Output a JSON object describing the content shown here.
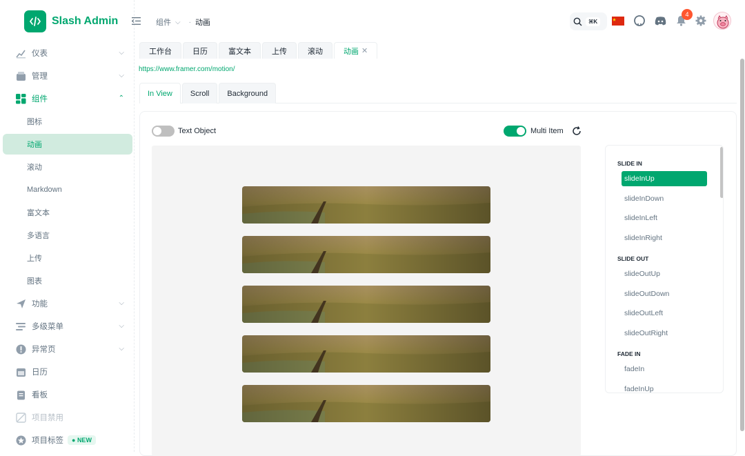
{
  "app": {
    "title": "Slash Admin"
  },
  "sidebar": {
    "items": [
      {
        "label": "仪表",
        "icon": "dashboard-icon",
        "expandable": true
      },
      {
        "label": "管理",
        "icon": "management-icon",
        "expandable": true
      },
      {
        "label": "组件",
        "icon": "components-icon",
        "expandable": true,
        "open": true
      },
      {
        "label": "功能",
        "icon": "send-icon",
        "expandable": true
      },
      {
        "label": "多级菜单",
        "icon": "menu-levels-icon",
        "expandable": true
      },
      {
        "label": "异常页",
        "icon": "error-icon",
        "expandable": true
      },
      {
        "label": "日历",
        "icon": "calendar-icon"
      },
      {
        "label": "看板",
        "icon": "kanban-icon"
      },
      {
        "label": "项目禁用",
        "icon": "disabled-icon",
        "disabled": true
      },
      {
        "label": "项目标签",
        "icon": "tag-icon",
        "badge": "NEW"
      }
    ],
    "sub_items": [
      "图标",
      "动画",
      "滚动",
      "Markdown",
      "富文本",
      "多语言",
      "上传",
      "图表"
    ],
    "active_sub": "动画"
  },
  "header": {
    "breadcrumb": [
      "组件",
      "动画"
    ],
    "search_shortcut": "⌘K",
    "notification_count": "4"
  },
  "tabs": [
    {
      "label": "工作台"
    },
    {
      "label": "日历"
    },
    {
      "label": "富文本"
    },
    {
      "label": "上传"
    },
    {
      "label": "滚动"
    },
    {
      "label": "动画",
      "active": true,
      "closable": "✕"
    }
  ],
  "url": "https://www.framer.com/motion/",
  "subtabs": [
    {
      "label": "In View",
      "active": true
    },
    {
      "label": "Scroll"
    },
    {
      "label": "Background"
    }
  ],
  "controls": {
    "text_object": {
      "label": "Text Object",
      "on": false
    },
    "multi_item": {
      "label": "Multi Item",
      "on": true
    }
  },
  "variants": {
    "groups": [
      {
        "title": "SLIDE IN",
        "items": [
          "slideInUp",
          "slideInDown",
          "slideInLeft",
          "slideInRight"
        ]
      },
      {
        "title": "SLIDE OUT",
        "items": [
          "slideOutUp",
          "slideOutDown",
          "slideOutLeft",
          "slideOutRight"
        ]
      },
      {
        "title": "FADE IN",
        "items": [
          "fadeIn",
          "fadeInUp"
        ]
      }
    ],
    "selected": "slideInUp"
  },
  "colors": {
    "primary": "#00a76f",
    "active_bg": "#d1ebdf",
    "toggle_off": "#bfbfbf",
    "badge": "#ff5630"
  }
}
